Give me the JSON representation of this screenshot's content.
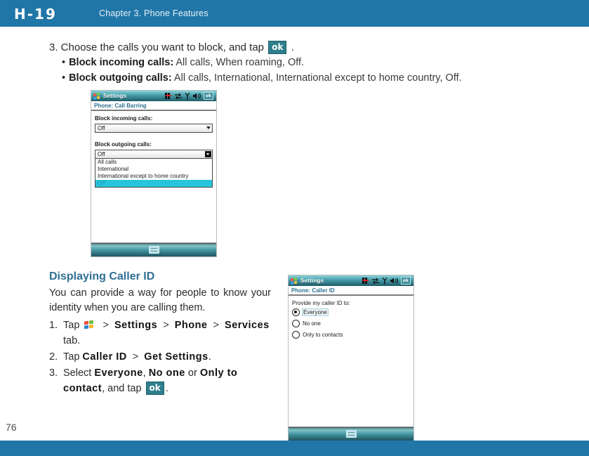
{
  "header": {
    "code": "H-19",
    "chapter": "Chapter 3. Phone Features"
  },
  "footer": {
    "page_number": "76"
  },
  "colors": {
    "header_blue": "#2176a8",
    "heading_blue": "#2f6f93",
    "ok_badge_teal": "#2e7f8c",
    "dropdown_highlight": "#27c4db"
  },
  "body": {
    "step3": {
      "prefix": "3. Choose the calls you want to block, and tap",
      "ok_label": "ok",
      "suffix": "."
    },
    "bullets": [
      {
        "dot": "•",
        "term": "Block incoming calls:",
        "desc": " All calls, When roaming, Off."
      },
      {
        "dot": "•",
        "term": "Block outgoing calls:",
        "desc": " All calls, International, International except to home country, Off."
      }
    ]
  },
  "article": {
    "heading": "Displaying Caller ID",
    "paragraph": "You can provide a way for people to know your identity when you are calling them.",
    "steps": [
      {
        "num": "1.",
        "pre": "Tap",
        "icon": "windows-start-flag",
        "gt1": ">",
        "b1": "Settings",
        "gt2": ">",
        "b2": "Phone",
        "gt3": ">",
        "b3": "Services",
        "post": "tab."
      },
      {
        "num": "2.",
        "pre": "Tap",
        "b1": "Caller ID",
        "gt1": ">",
        "b2": "Get Settings",
        "post": "."
      },
      {
        "num": "3.",
        "pre": "Select",
        "b1": "Everyone",
        "sep1": ",",
        "b2": "No one",
        "sep2": "or",
        "b3": "Only to contact",
        "post": ", and tap",
        "ok_label": "ok",
        "end": "."
      }
    ]
  },
  "device_call_barring": {
    "titlebar": {
      "start_icon": "windows-start-flag",
      "title": "Settings",
      "icons": [
        "signal-tower-icon",
        "data-transfer-icon",
        "antenna-icon",
        "speaker-icon"
      ],
      "ok_label": "ok"
    },
    "subtitle": "Phone: Call Barring",
    "incoming": {
      "label": "Block incoming calls:",
      "value": "Off"
    },
    "outgoing": {
      "label": "Block outgoing calls:",
      "value": "Off",
      "options": [
        "All calls",
        "International",
        "International except to home country",
        "Off"
      ],
      "selected_index": 3
    },
    "taskbar_icon": "keyboard-icon"
  },
  "device_caller_id": {
    "titlebar": {
      "start_icon": "windows-start-flag",
      "title": "Settings",
      "icons": [
        "signal-tower-icon",
        "data-transfer-icon",
        "antenna-icon",
        "speaker-icon"
      ],
      "ok_label": "ok"
    },
    "subtitle": "Phone: Caller ID",
    "prompt": "Provide my caller ID to:",
    "options": [
      {
        "label": "Everyone",
        "selected": true
      },
      {
        "label": "No one",
        "selected": false
      },
      {
        "label": "Only to contacts",
        "selected": false
      }
    ],
    "taskbar_icon": "keyboard-icon"
  }
}
